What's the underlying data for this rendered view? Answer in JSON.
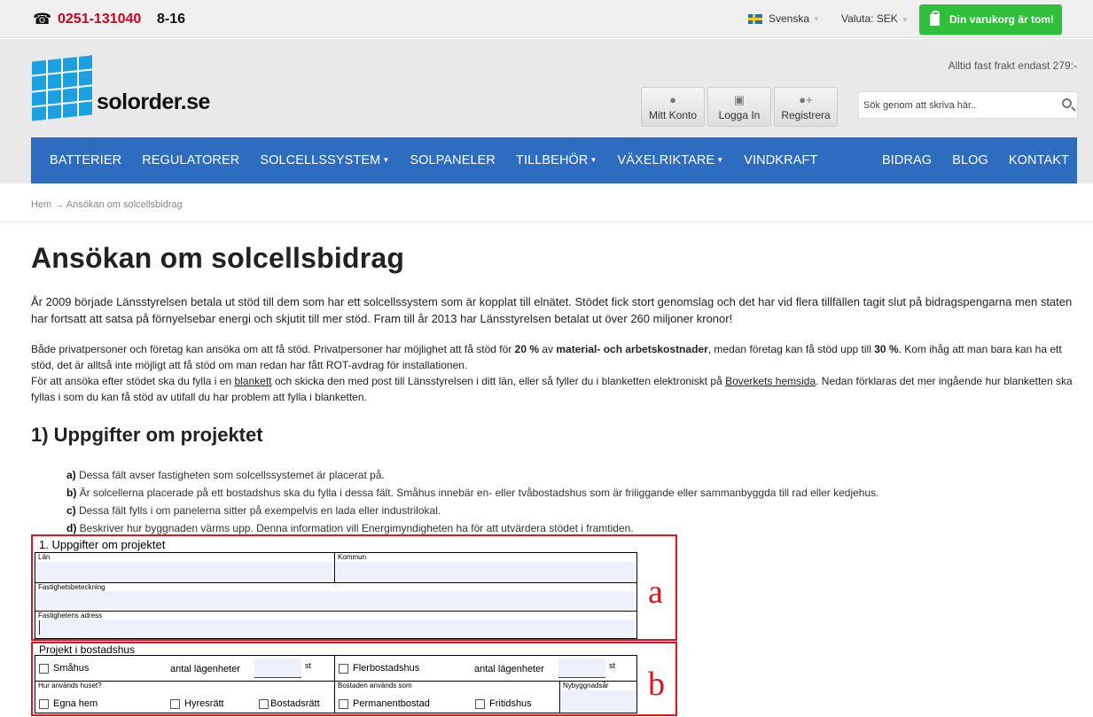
{
  "topbar": {
    "phone_icon": "☎",
    "phone": "0251-131040",
    "hours": "8-16",
    "language": "Svenska",
    "currency": "Valuta: SEK",
    "cart": "Din varukorg är tom!"
  },
  "header": {
    "logo_text": "solorder.se",
    "freight_note": "Alltid fast frakt endast 279:-",
    "account_buttons": [
      {
        "label": "Mitt Konto",
        "icon": "user-icon"
      },
      {
        "label": "Logga In",
        "icon": "lock-icon"
      },
      {
        "label": "Registrera",
        "icon": "user-plus-icon"
      }
    ],
    "search_placeholder": "Sök genom att skriva här.."
  },
  "nav": {
    "left": [
      {
        "label": "BATTERIER",
        "dropdown": false
      },
      {
        "label": "REGULATORER",
        "dropdown": false
      },
      {
        "label": "SOLCELLSSYSTEM",
        "dropdown": true
      },
      {
        "label": "SOLPANELER",
        "dropdown": false
      },
      {
        "label": "TILLBEHÖR",
        "dropdown": true
      },
      {
        "label": "VÄXELRIKTARE",
        "dropdown": true
      },
      {
        "label": "VINDKRAFT",
        "dropdown": false
      }
    ],
    "right": [
      {
        "label": "BIDRAG"
      },
      {
        "label": "BLOG"
      },
      {
        "label": "KONTAKT"
      }
    ]
  },
  "breadcrumb": {
    "home": "Hem",
    "separator": "→",
    "current": "Ansökan om solcellsbidrag"
  },
  "page": {
    "title": "Ansökan om solcellsbidrag",
    "intro": "År 2009 började Länsstyrelsen betala ut stöd till dem som har ett solcellssystem som är kopplat till elnätet. Stödet fick stort genomslag och det har vid flera tillfällen tagit slut på bidragspengarna men staten har fortsatt att satsa på förnyelsebar energi och skjutit till mer stöd. Fram till år 2013 har Länsstyrelsen betalat ut över 260 miljoner kronor!",
    "p2_a": "Både privatpersoner och företag kan ansöka om att få stöd. Privatpersoner har möjlighet att få stöd för ",
    "p2_b": "20 %",
    "p2_c": " av ",
    "p2_d": "material- och arbetskostnader",
    "p2_e": ", medan företag kan få stöd upp till ",
    "p2_f": "30 %",
    "p2_g": ". Kom ihåg att man bara kan ha ett stöd, det är alltså inte möjligt att få stöd om man redan har fått ROT-avdrag för installationen.",
    "p3_a": "För att ansöka efter stödet ska du fylla i en ",
    "p3_link1": "blankett",
    "p3_b": " och skicka den med post till Länsstyrelsen i ditt län, eller så fyller du i blanketten elektroniskt på ",
    "p3_link2": "Boverkets hemsida",
    "p3_c": ". Nedan förklaras det mer ingående hur blanketten ska fyllas i som du kan få stöd av utifall du har problem att fylla i blanketten.",
    "section_title": "1) Uppgifter om projektet",
    "hints": [
      {
        "key": "a)",
        "text": " Dessa fält avser fastigheten som solcellssystemet är placerat på."
      },
      {
        "key": "b)",
        "text": " Är solcellerna placerade på ett bostadshus ska du fylla i dessa fält. Småhus innebär en- eller tvåbostadshus som är friliggande eller sammanbyggda till rad eller kedjehus."
      },
      {
        "key": "c)",
        "text": " Dessa fält fylls i om panelerna sitter på exempelvis en lada eller industrilokal."
      },
      {
        "key": "d)",
        "text": " Beskriver hur byggnaden värms upp. Denna information vill Energimyndigheten ha för att utvärdera stödet i framtiden."
      }
    ]
  },
  "form_a": {
    "letter": "a",
    "title": "1. Uppgifter om projektet",
    "lan": "Län",
    "kommun": "Kommun",
    "fastighetsbeteckning": "Fastighetsbeteckning",
    "adress": "Fastighetens adress"
  },
  "form_b": {
    "letter": "b",
    "title": "Projekt i bostadshus",
    "smahus": "Småhus",
    "antal1": "antal lägenheter",
    "st1": "st",
    "flerbostadshus": "Flerbostadshus",
    "antal2": "antal lägenheter",
    "st2": "st",
    "hur_anvands": "Hur används huset?",
    "egna_hem": "Egna hem",
    "hyresratt": "Hyresrätt",
    "bostadsratt": "Bostadsrätt",
    "bostaden_anvands": "Bostaden används som",
    "permanentbostad": "Permanentbostad",
    "fritidshus": "Fritidshus",
    "nybyggnadsar": "Nybyggnadsår"
  },
  "colors": {
    "nav_bg": "#2e6cbf",
    "cart_green": "#2fbf3a",
    "phone_red": "#d0021b",
    "annotation_red": "#e3121e",
    "logo_blue": "#1ba1e2",
    "field_fill": "#eef1fb"
  }
}
